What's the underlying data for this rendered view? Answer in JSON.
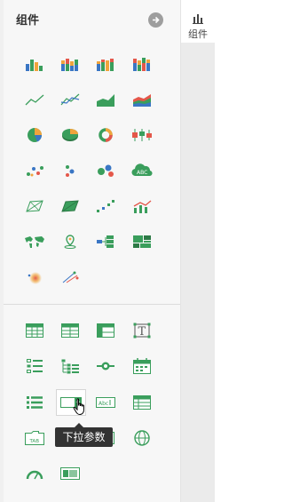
{
  "panel": {
    "title": "组件",
    "collapse_icon": "arrow-right-circle-icon"
  },
  "right_tab": {
    "label": "组件",
    "icon": "bar-chart-icon"
  },
  "tooltip": "下拉参数",
  "colors": {
    "green": "#3a9e5c",
    "orange": "#f0a43c",
    "blue": "#3a76c4",
    "red": "#e4574a",
    "dark_green": "#2d7a46"
  },
  "charts": [
    "bar-chart-icon",
    "stacked-bar-chart-icon",
    "percent-bar-chart-icon",
    "multi-stacked-bar-icon",
    "line-chart-icon",
    "multi-line-chart-icon",
    "area-chart-icon",
    "stacked-area-chart-icon",
    "pie-chart-icon",
    "3d-pie-chart-icon",
    "donut-chart-icon",
    "box-plot-icon",
    "scatter-chart-icon",
    "bubble-chart-icon",
    "multi-bubble-chart-icon",
    "word-cloud-icon",
    "radar-chart-icon",
    "filled-radar-icon",
    "point-line-icon",
    "combo-chart-icon",
    "world-map-icon",
    "location-map-icon",
    "funnel-icon",
    "treemap-icon",
    "heatmap-icon",
    "flow-map-icon"
  ],
  "widgets": [
    "table-icon",
    "detail-table-icon",
    "cross-table-icon",
    "text-icon",
    "list-icon",
    "tree-list-icon",
    "slider-icon",
    "calendar-icon",
    "bullet-list-icon",
    "dropdown-param-icon",
    "text-input-icon",
    "form-table-icon",
    "tab-icon",
    "button-icon",
    "image-icon",
    "web-icon",
    "gauge-icon",
    "media-icon"
  ]
}
